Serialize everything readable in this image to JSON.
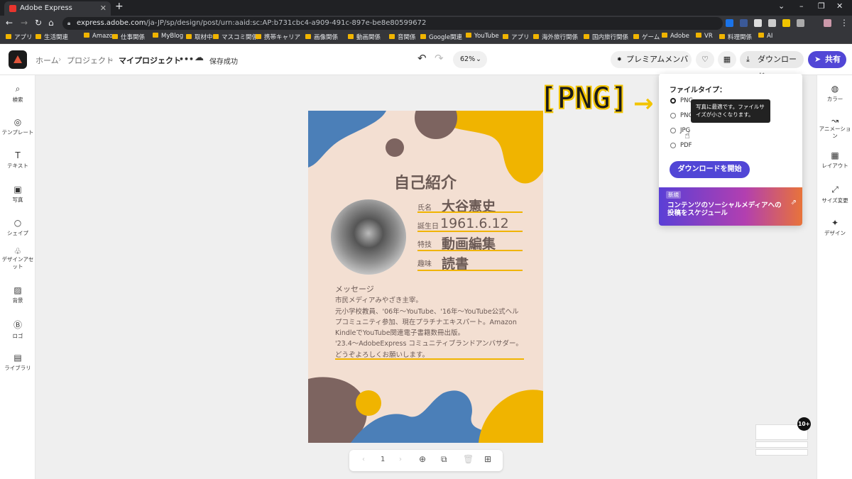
{
  "browser": {
    "tab_title": "Adobe Express",
    "url_host": "express.adobe.com",
    "url_path": "/ja-JP/sp/design/post/urn:aaid:sc:AP:b731cbc4-a909-491c-897e-be8e80599672"
  },
  "bookmarks": [
    "アプリ",
    "生活関連",
    "Amazon",
    "仕事関係",
    "MyBlog",
    "取材中",
    "マスコミ関係",
    "携帯キャリア",
    "画像関係",
    "動画関係",
    "音関係",
    "Google関連",
    "YouTube",
    "アプリ",
    "海外旅行関係",
    "国内旅行関係",
    "ゲーム",
    "Adobe",
    "VR",
    "料理関係",
    "AI"
  ],
  "header": {
    "breadcrumb": [
      "ホーム",
      "プロジェクト",
      "マイプロジェクト"
    ],
    "more": "•••",
    "save_status": "保存成功",
    "zoom": "62%",
    "premium_label": "プレミアムメンバー",
    "download_label": "ダウンロード",
    "share_label": "共有"
  },
  "left_sidebar": [
    "検索",
    "テンプレート",
    "テキスト",
    "写真",
    "シェイプ",
    "デザインアセット",
    "背景",
    "ロゴ",
    "ライブラリ"
  ],
  "right_sidebar": [
    "カラー",
    "アニメーション",
    "レイアウト",
    "サイズ変更",
    "デザイン"
  ],
  "download_menu": {
    "heading": "ファイルタイプ：",
    "options": [
      {
        "label": "PNG",
        "selected": true
      },
      {
        "label": "PNG",
        "selected": false
      },
      {
        "label": "JPG",
        "selected": false
      },
      {
        "label": "PDF",
        "selected": false
      }
    ],
    "tooltip": "写真に最適です。ファイルサイズが小さくなります。",
    "start_button": "ダウンロードを開始",
    "promo_badge": "新規",
    "promo_text": "コンテンツのソーシャルメディアへの投稿をスケジュール"
  },
  "annotation": {
    "text": "[PNG]",
    "arrow": "→"
  },
  "card": {
    "title": "自己紹介",
    "fields": [
      {
        "label": "氏名",
        "value": "大谷憲史"
      },
      {
        "label": "誕生日",
        "value": "1961.6.12"
      },
      {
        "label": "特技",
        "value": "動画編集"
      },
      {
        "label": "趣味",
        "value": "読書"
      }
    ],
    "message_heading": "メッセージ",
    "message_lines": [
      "市民メディアみやざき主宰。",
      "元小学校教員、'06年〜YouTube、'16年〜YouTube公式ヘル",
      "プコミュニティ参加、現在プラチナエキスパート。Amazon",
      "KindleでYouTube関連電子書籍数冊出版。",
      "'23.4〜AdobeExpress コミュニティブランドアンバサダー。",
      "どうぞよろしくお願いします。"
    ]
  },
  "pager": {
    "page": "1",
    "prev": "‹",
    "next": "›"
  },
  "thumbs_badge": "10+",
  "colors": {
    "blue": "#4b7fb8",
    "yellow": "#f0b400",
    "brown": "#7d6460",
    "bg": "#f3dfd2",
    "accent": "#5146d6"
  }
}
